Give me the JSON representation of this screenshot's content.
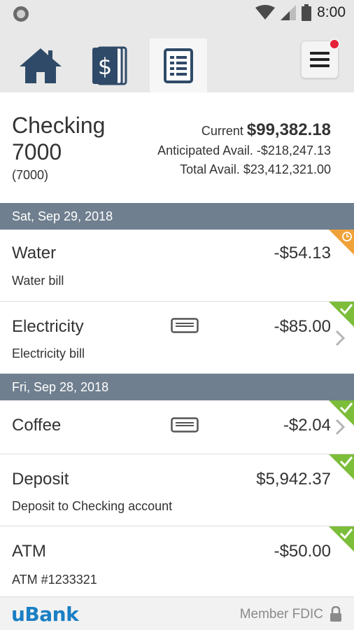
{
  "status_bar": {
    "time": "8:00",
    "icons": [
      "record-icon",
      "wifi-icon",
      "signal-icon",
      "battery-icon"
    ]
  },
  "nav": {
    "tabs": [
      {
        "name": "home",
        "icon": "home-icon",
        "active": false
      },
      {
        "name": "transfers",
        "icon": "dollar-icon",
        "active": false
      },
      {
        "name": "accounts",
        "icon": "document-list-icon",
        "active": true
      }
    ],
    "menu_icon": "hamburger-menu-icon",
    "has_notification": true
  },
  "account": {
    "name": "Checking 7000",
    "sub": "(7000)",
    "current_label": "Current",
    "current_value": "$99,382.18",
    "anticipated": "Anticipated Avail. -$218,247.13",
    "total": "Total Avail. $23,412,321.00"
  },
  "groups": [
    {
      "date": "Sat, Sep 29, 2018",
      "transactions": [
        {
          "title": "Water",
          "desc": "Water bill",
          "amount": "-$54.13",
          "status": "pending"
        },
        {
          "title": "Electricity",
          "desc": "Electricity bill",
          "amount": "-$85.00",
          "status": "cleared",
          "card": true,
          "chevron": true
        }
      ]
    },
    {
      "date": "Fri, Sep 28, 2018",
      "transactions": [
        {
          "title": "Coffee",
          "desc": "",
          "amount": "-$2.04",
          "status": "cleared",
          "card": true,
          "chevron": true
        },
        {
          "title": "Deposit",
          "desc": "Deposit to Checking account",
          "amount": "$5,942.37",
          "status": "cleared"
        },
        {
          "title": "ATM",
          "desc": "ATM #1233321",
          "amount": "-$50.00",
          "status": "cleared"
        }
      ]
    }
  ],
  "footer": {
    "brand": "uBank",
    "fdic": "Member FDIC"
  },
  "colors": {
    "nav_icon": "#2f4a68",
    "date_header": "#6f7f8f",
    "cleared": "#7cbd3a",
    "pending": "#f0a23a",
    "brand": "#1a7fc4",
    "notification": "#e5213a"
  }
}
